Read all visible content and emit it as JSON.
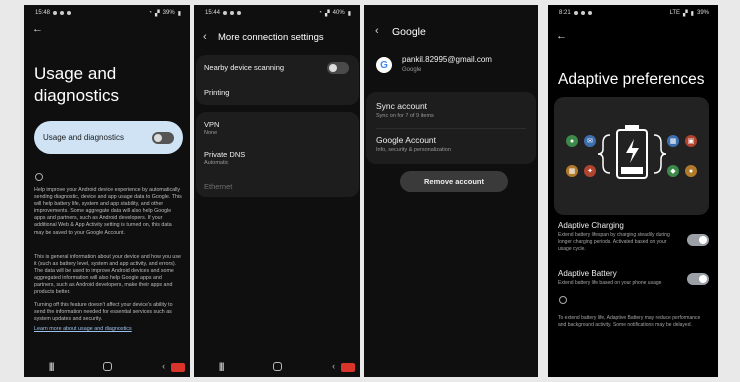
{
  "phone1": {
    "status": {
      "time": "15:48",
      "battery": "39%"
    },
    "title_line1": "Usage and",
    "title_line2": "diagnostics",
    "toggle_label": "Usage and diagnostics",
    "para1": "Help improve your Android device experience by automatically sending diagnostic, device and app usage data to Google. This will help battery life, system and app stability, and other improvements. Some aggregate data will also help Google apps and partners, such as Android developers. If your additional Web & App Activity setting is turned on, this data may be saved to your Google Account.",
    "para2": "This is general information about your device and how you use it (such as battery level, system and app activity, and errors). The data will be used to improve Android devices and some aggregated information will also help Google apps and partners, such as Android developers, make their apps and products better.",
    "para3": "Turning off this feature doesn't affect your device's ability to send the information needed for essential services such as system updates and security.",
    "link": "Learn more about usage and diagnostics"
  },
  "phone2": {
    "status": {
      "time": "15:44",
      "battery": "40%"
    },
    "header": "More connection settings",
    "items": [
      {
        "title": "Nearby device scanning"
      },
      {
        "title": "Printing"
      },
      {
        "title": "VPN",
        "sub": "None"
      },
      {
        "title": "Private DNS",
        "sub": "Automatic"
      },
      {
        "title": "Ethernet"
      }
    ]
  },
  "phone3": {
    "header": "Google",
    "email": "pankil.82995@gmail.com",
    "account_type": "Google",
    "sync_title": "Sync account",
    "sync_sub": "Sync on for 7 of 9 items",
    "ga_title": "Google Account",
    "ga_sub": "Info, security & personalization",
    "remove": "Remove account"
  },
  "phone4": {
    "status": {
      "time": "8:21",
      "network": "LTE",
      "battery": "39%"
    },
    "title": "Adaptive preferences",
    "charging_title": "Adaptive Charging",
    "charging_sub": "Extend battery lifespan by charging steadily during longer charging periods. Activated based on your usage cycle.",
    "battery_title": "Adaptive Battery",
    "battery_sub": "Extend battery life based on your phone usage",
    "footer": "To extend battery life, Adaptive Battery may reduce performance and background activity. Some notifications may be delayed."
  },
  "colors": {
    "toggle_card": "#cfe3f5",
    "link": "#9bc0ea",
    "keyboard_badge": "#d9342b"
  }
}
